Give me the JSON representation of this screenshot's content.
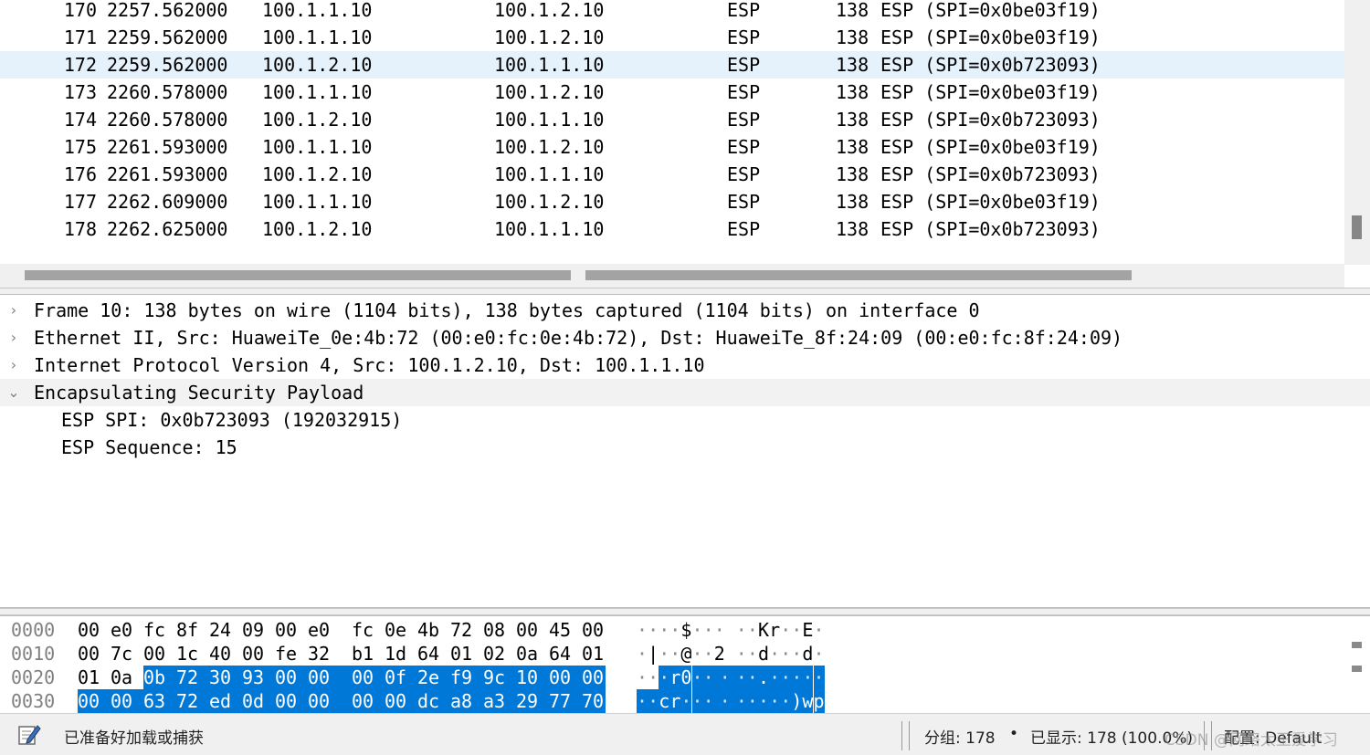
{
  "packet_list": {
    "rows": [
      {
        "no": "170",
        "time": "2257.562000",
        "src": "100.1.1.10",
        "dst": "100.1.2.10",
        "proto": "ESP",
        "len": "138",
        "info": "ESP (SPI=0x0be03f19)"
      },
      {
        "no": "171",
        "time": "2259.562000",
        "src": "100.1.1.10",
        "dst": "100.1.2.10",
        "proto": "ESP",
        "len": "138",
        "info": "ESP (SPI=0x0be03f19)"
      },
      {
        "no": "172",
        "time": "2259.562000",
        "src": "100.1.2.10",
        "dst": "100.1.1.10",
        "proto": "ESP",
        "len": "138",
        "info": "ESP (SPI=0x0b723093)"
      },
      {
        "no": "173",
        "time": "2260.578000",
        "src": "100.1.1.10",
        "dst": "100.1.2.10",
        "proto": "ESP",
        "len": "138",
        "info": "ESP (SPI=0x0be03f19)"
      },
      {
        "no": "174",
        "time": "2260.578000",
        "src": "100.1.2.10",
        "dst": "100.1.1.10",
        "proto": "ESP",
        "len": "138",
        "info": "ESP (SPI=0x0b723093)"
      },
      {
        "no": "175",
        "time": "2261.593000",
        "src": "100.1.1.10",
        "dst": "100.1.2.10",
        "proto": "ESP",
        "len": "138",
        "info": "ESP (SPI=0x0be03f19)"
      },
      {
        "no": "176",
        "time": "2261.593000",
        "src": "100.1.2.10",
        "dst": "100.1.1.10",
        "proto": "ESP",
        "len": "138",
        "info": "ESP (SPI=0x0b723093)"
      },
      {
        "no": "177",
        "time": "2262.609000",
        "src": "100.1.1.10",
        "dst": "100.1.2.10",
        "proto": "ESP",
        "len": "138",
        "info": "ESP (SPI=0x0be03f19)"
      },
      {
        "no": "178",
        "time": "2262.625000",
        "src": "100.1.2.10",
        "dst": "100.1.1.10",
        "proto": "ESP",
        "len": "138",
        "info": "ESP (SPI=0x0b723093)"
      }
    ],
    "selected_no": "172",
    "selected_color": "#e5f1fb"
  },
  "details": {
    "items": [
      {
        "text": "Frame 10: 138 bytes on wire (1104 bits), 138 bytes captured (1104 bits) on interface 0",
        "expanded": false
      },
      {
        "text": "Ethernet II, Src: HuaweiTe_0e:4b:72 (00:e0:fc:0e:4b:72), Dst: HuaweiTe_8f:24:09 (00:e0:fc:8f:24:09)",
        "expanded": false
      },
      {
        "text": "Internet Protocol Version 4, Src: 100.1.2.10, Dst: 100.1.1.10",
        "expanded": false
      },
      {
        "text": "Encapsulating Security Payload",
        "expanded": true
      }
    ],
    "children": [
      {
        "text": "ESP SPI: 0x0b723093 (192032915)"
      },
      {
        "text": "ESP Sequence: 15"
      }
    ],
    "collapsed_icon": "chevron-right-icon",
    "expanded_icon": "chevron-down-icon"
  },
  "bytes": {
    "highlight_color": "#0078d7",
    "rows": [
      {
        "offset": "0000",
        "hex": [
          "00",
          "e0",
          "fc",
          "8f",
          "24",
          "09",
          "00",
          "e0",
          "fc",
          "0e",
          "4b",
          "72",
          "08",
          "00",
          "45",
          "00"
        ],
        "ascii": [
          "·",
          "·",
          "·",
          "·",
          "$",
          "·",
          "·",
          "·",
          "·",
          "·",
          "K",
          "r",
          "·",
          "·",
          "E",
          "·"
        ],
        "hl_from": 16
      },
      {
        "offset": "0010",
        "hex": [
          "00",
          "7c",
          "00",
          "1c",
          "40",
          "00",
          "fe",
          "32",
          "b1",
          "1d",
          "64",
          "01",
          "02",
          "0a",
          "64",
          "01"
        ],
        "ascii": [
          "·",
          "|",
          "·",
          "·",
          "@",
          "·",
          "·",
          "2",
          "·",
          "·",
          "d",
          "·",
          "·",
          "·",
          "d",
          "·"
        ],
        "hl_from": 16
      },
      {
        "offset": "0020",
        "hex": [
          "01",
          "0a",
          "0b",
          "72",
          "30",
          "93",
          "00",
          "00",
          "00",
          "0f",
          "2e",
          "f9",
          "9c",
          "10",
          "00",
          "00"
        ],
        "ascii": [
          "·",
          "·",
          "·",
          "r",
          "0",
          "·",
          "·",
          "·",
          "·",
          "·",
          ".",
          "·",
          "·",
          "·",
          "·",
          "·"
        ],
        "hl_from": 2
      },
      {
        "offset": "0030",
        "hex": [
          "00",
          "00",
          "63",
          "72",
          "ed",
          "0d",
          "00",
          "00",
          "00",
          "00",
          "dc",
          "a8",
          "a3",
          "29",
          "77",
          "70"
        ],
        "ascii": [
          "·",
          "·",
          "c",
          "r",
          "·",
          "·",
          "·",
          "·",
          "·",
          "·",
          "·",
          "·",
          "·",
          ")",
          "w",
          "p"
        ],
        "hl_from": 0
      }
    ]
  },
  "statusbar": {
    "icon": "capture-ready-icon",
    "status_text": "已准备好加载或捕获",
    "packets": "分组: 178",
    "dot": "•",
    "shown": "已显示: 178 (100.0%)",
    "profile": "配置: Default",
    "watermark": "CSDN @网络太王爱学习"
  }
}
